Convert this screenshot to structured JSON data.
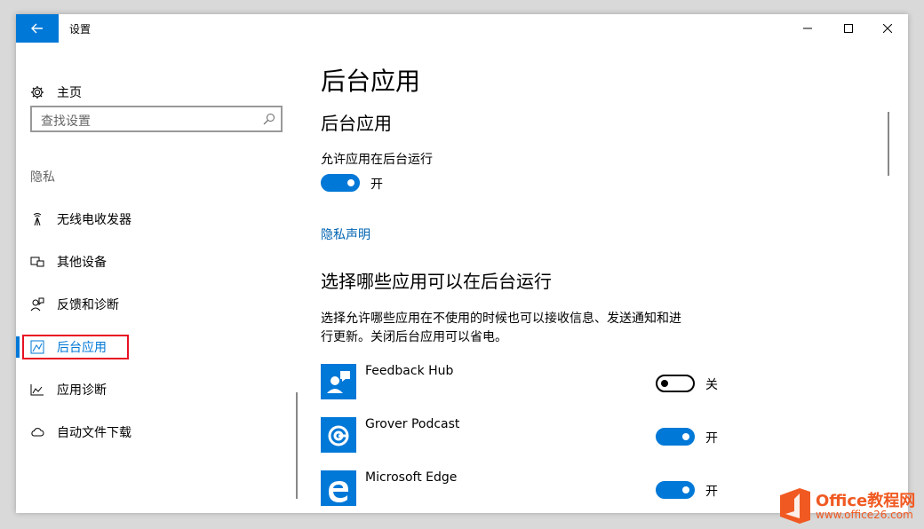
{
  "window": {
    "title": "设置"
  },
  "sidebar": {
    "home_label": "主页",
    "search_placeholder": "查找设置",
    "group_label": "隐私",
    "items": [
      {
        "label": "无线电收发器",
        "icon": "radio-tower-icon"
      },
      {
        "label": "其他设备",
        "icon": "devices-icon"
      },
      {
        "label": "反馈和诊断",
        "icon": "feedback-icon"
      },
      {
        "label": "后台应用",
        "icon": "background-apps-icon",
        "selected": true
      },
      {
        "label": "应用诊断",
        "icon": "app-diagnostics-icon"
      },
      {
        "label": "自动文件下载",
        "icon": "cloud-icon"
      }
    ]
  },
  "main": {
    "page_title": "后台应用",
    "section1_title": "后台应用",
    "allow_label": "允许应用在后台运行",
    "allow_state": "开",
    "privacy_link": "隐私声明",
    "section2_title": "选择哪些应用可以在后台运行",
    "description_line1": "选择允许哪些应用在不使用的时候也可以接收信息、发送通知和进",
    "description_line2": "行更新。关闭后台应用可以省电。",
    "apps": [
      {
        "name": "Feedback Hub",
        "state": "关",
        "on": false
      },
      {
        "name": "Grover Podcast",
        "state": "开",
        "on": true
      },
      {
        "name": "Microsoft Edge",
        "state": "开",
        "on": true
      }
    ]
  },
  "watermark": {
    "brand": "Office教程网",
    "url": "www.office26.com"
  },
  "colors": {
    "accent": "#0078d7",
    "highlight_box": "#e81123",
    "watermark_orange": "#f05a22"
  }
}
